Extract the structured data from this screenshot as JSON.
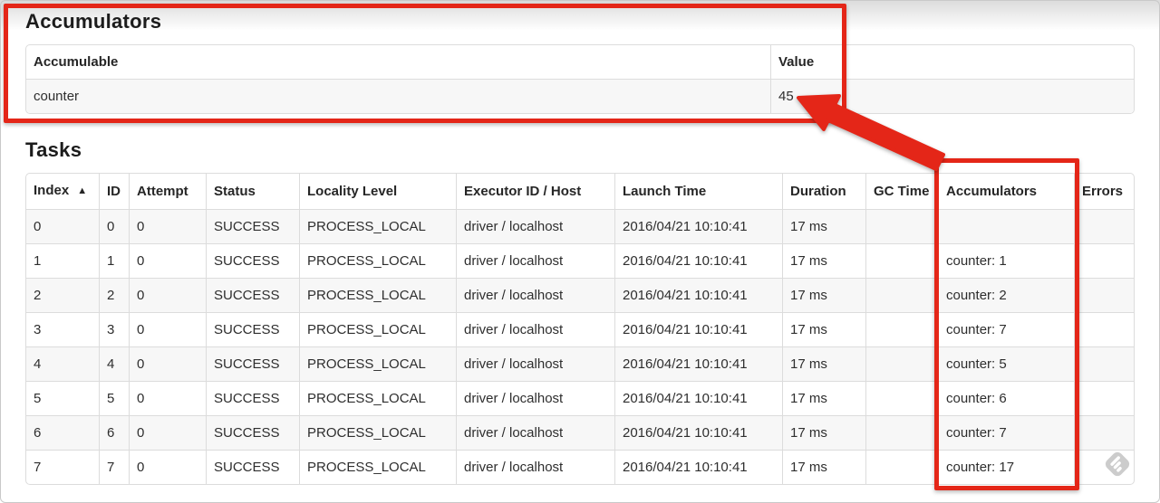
{
  "accumulators_section": {
    "title": "Accumulators",
    "table": {
      "headers": [
        "Accumulable",
        "Value"
      ],
      "column_keys": [
        "accumulable",
        "value"
      ],
      "rows": [
        {
          "accumulable": "counter",
          "value": "45"
        }
      ]
    }
  },
  "tasks_section": {
    "title": "Tasks",
    "table": {
      "headers": [
        "Index",
        "ID",
        "Attempt",
        "Status",
        "Locality Level",
        "Executor ID / Host",
        "Launch Time",
        "Duration",
        "GC Time",
        "Accumulators",
        "Errors"
      ],
      "column_keys": [
        "index",
        "id",
        "attempt",
        "status",
        "locality_level",
        "executor_id_host",
        "launch_time",
        "duration",
        "gc_time",
        "accumulators",
        "errors"
      ],
      "sort_column": "Index",
      "sort_icon": "▲",
      "rows": [
        {
          "index": "0",
          "id": "0",
          "attempt": "0",
          "status": "SUCCESS",
          "locality_level": "PROCESS_LOCAL",
          "executor_id_host": "driver / localhost",
          "launch_time": "2016/04/21 10:10:41",
          "duration": "17 ms",
          "gc_time": "",
          "accumulators": "",
          "errors": ""
        },
        {
          "index": "1",
          "id": "1",
          "attempt": "0",
          "status": "SUCCESS",
          "locality_level": "PROCESS_LOCAL",
          "executor_id_host": "driver / localhost",
          "launch_time": "2016/04/21 10:10:41",
          "duration": "17 ms",
          "gc_time": "",
          "accumulators": "counter: 1",
          "errors": ""
        },
        {
          "index": "2",
          "id": "2",
          "attempt": "0",
          "status": "SUCCESS",
          "locality_level": "PROCESS_LOCAL",
          "executor_id_host": "driver / localhost",
          "launch_time": "2016/04/21 10:10:41",
          "duration": "17 ms",
          "gc_time": "",
          "accumulators": "counter: 2",
          "errors": ""
        },
        {
          "index": "3",
          "id": "3",
          "attempt": "0",
          "status": "SUCCESS",
          "locality_level": "PROCESS_LOCAL",
          "executor_id_host": "driver / localhost",
          "launch_time": "2016/04/21 10:10:41",
          "duration": "17 ms",
          "gc_time": "",
          "accumulators": "counter: 7",
          "errors": ""
        },
        {
          "index": "4",
          "id": "4",
          "attempt": "0",
          "status": "SUCCESS",
          "locality_level": "PROCESS_LOCAL",
          "executor_id_host": "driver / localhost",
          "launch_time": "2016/04/21 10:10:41",
          "duration": "17 ms",
          "gc_time": "",
          "accumulators": "counter: 5",
          "errors": ""
        },
        {
          "index": "5",
          "id": "5",
          "attempt": "0",
          "status": "SUCCESS",
          "locality_level": "PROCESS_LOCAL",
          "executor_id_host": "driver / localhost",
          "launch_time": "2016/04/21 10:10:41",
          "duration": "17 ms",
          "gc_time": "",
          "accumulators": "counter: 6",
          "errors": ""
        },
        {
          "index": "6",
          "id": "6",
          "attempt": "0",
          "status": "SUCCESS",
          "locality_level": "PROCESS_LOCAL",
          "executor_id_host": "driver / localhost",
          "launch_time": "2016/04/21 10:10:41",
          "duration": "17 ms",
          "gc_time": "",
          "accumulators": "counter: 7",
          "errors": ""
        },
        {
          "index": "7",
          "id": "7",
          "attempt": "0",
          "status": "SUCCESS",
          "locality_level": "PROCESS_LOCAL",
          "executor_id_host": "driver / localhost",
          "launch_time": "2016/04/21 10:10:41",
          "duration": "17 ms",
          "gc_time": "",
          "accumulators": "counter: 17",
          "errors": ""
        }
      ]
    }
  },
  "annotations": {
    "highlight_color": "#e42618",
    "arrow_target_value": "45",
    "watermark_color": "#cccccc"
  }
}
